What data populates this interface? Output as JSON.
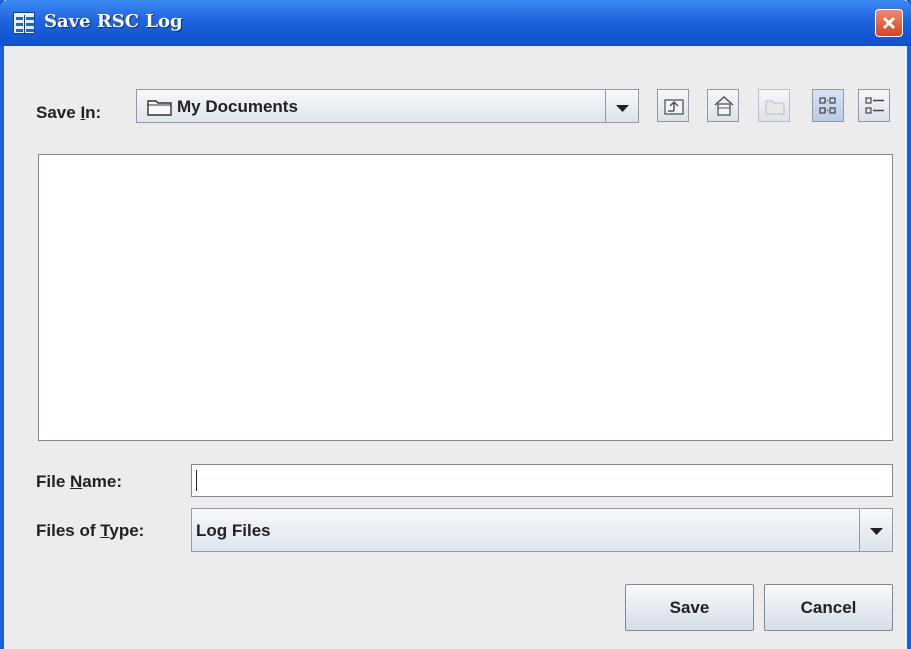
{
  "window": {
    "title": "Save RSC Log"
  },
  "save_in": {
    "label_prefix": "Save ",
    "label_mnemonic": "I",
    "label_suffix": "n:",
    "value": "My Documents"
  },
  "toolbar": {
    "icons": [
      "up-one-level-icon",
      "home-icon",
      "new-folder-icon",
      "list-view-icon",
      "details-view-icon"
    ]
  },
  "file_name": {
    "label_prefix": "File ",
    "label_mnemonic": "N",
    "label_suffix": "ame:",
    "value": ""
  },
  "file_type": {
    "label_prefix": "Files of ",
    "label_mnemonic": "T",
    "label_suffix": "ype:",
    "value": "Log Files"
  },
  "buttons": {
    "save": "Save",
    "cancel": "Cancel"
  },
  "colors": {
    "title_bar": "#1f63de",
    "close_button": "#d5451e",
    "dialog_bg": "#ececec"
  }
}
